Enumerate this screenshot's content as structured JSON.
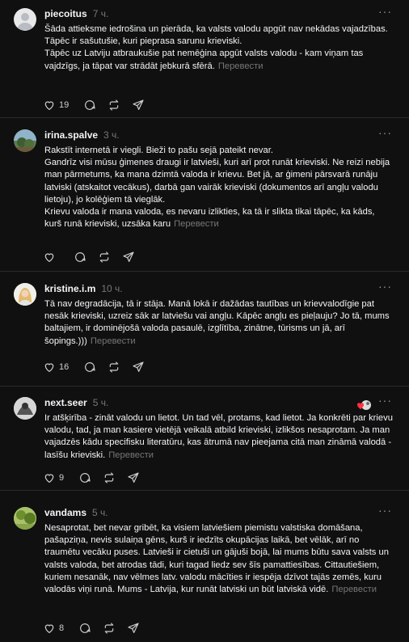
{
  "posts": [
    {
      "username": "piecoitus",
      "time": "7 ч.",
      "paragraphs": [
        "Šāda attieksme iedrošina un pierāda, ka valsts valodu apgūt nav nekādas vajadzības.",
        "Tāpēc ir sašutušie, kuri pieprasa sarunu krieviski.",
        "Tāpēc uz Latviju atbraukušie pat nemēģina apgūt valsts valodu - kam viņam tas vajdzīgs, ja tāpat var strādāt jebkurā sfērā."
      ],
      "translate": "Перевести",
      "likes": "19",
      "avatar_color": "#e8e8ea"
    },
    {
      "username": "irina.spalve",
      "time": "3 ч.",
      "paragraphs": [
        "Rakstīt internetā ir viegli. Bieži to pašu sejā pateikt nevar.",
        "Gandrīz visi mūsu ģimenes draugi ir latvieši, kuri arī prot runāt krieviski. Ne reizi nebija man pārmetums, ka mana dzimtā valoda ir krievu. Bet jā, ar ģimeni pārsvarā runāju latviski (atskaitot vecākus), darbā gan vairāk krieviski (dokumentos arī angļu valodu lietoju), jo kolēģiem tā vieglāk.",
        "Krievu valoda ir mana valoda, es nevaru izlikties, ka tā ir slikta tikai tāpēc, ka kāds, kurš runā krieviski, uzsāka karu"
      ],
      "translate": "Перевести",
      "likes": "",
      "avatar_color": "#5f7a52"
    },
    {
      "username": "kristine.i.m",
      "time": "10 ч.",
      "paragraphs": [
        "Tā nav degradācija, tā ir stāja. Manā lokā ir dažādas tautības un krievvalodīgie pat nesāk krieviski, uzreiz sāk ar latviešu vai angļu. Kāpēc angļu es pieļauju? Jo tā, mums baltajiem, ir dominējošā valoda pasaulē, izglītība, zinātne, tūrisms un jā, arī šopings.)))"
      ],
      "translate": "Перевести",
      "likes": "16",
      "avatar_color": "#e9c98e"
    },
    {
      "username": "next.seer",
      "time": "5 ч.",
      "paragraphs": [
        "Ir atšķirība - zināt valodu un lietot. Un tad vēl, protams, kad lietot. Ja konkrēti par krievu valodu, tad, ja man kasiere vietējā veikalā atbild krieviski, izlikšos nesaprotam. Ja man vajadzēs kādu specifisku literatūru, kas ātrumā nav pieejama citā man zināmā valodā - lasīšu krieviski."
      ],
      "translate": "Перевести",
      "likes": "9",
      "avatar_color": "#cfcfcf"
    },
    {
      "username": "vandams",
      "time": "5 ч.",
      "paragraphs": [
        "Nesaprotat, bet nevar gribēt, ka visiem latviešiem piemistu valstiska domāšana, pašapziņa, nevis sulaiņa gēns, kurš ir iedzīts okupācijas laikā, bet vēlāk, arī no traumētu vecāku puses. Latvieši ir cietuši un gājuši bojā, lai mums būtu sava valsts un valsts valoda, bet atrodas tādi, kuri tagad liedz sev šīs pamattiesības. Cittautiešiem, kuriem nesanāk, nav vēlmes latv. valodu mācīties ir iespēja dzīvot tajās zemēs, kuru valodās viņi runā. Mums - Latvija, kur runāt latviski un būt latviskā vidē."
      ],
      "translate": "Перевести",
      "likes": "8",
      "avatar_color": "#7e9a3c"
    }
  ],
  "icons": [
    "heart-icon",
    "comment-icon",
    "repost-icon",
    "share-icon",
    "more-icon"
  ],
  "more_glyph": "···"
}
